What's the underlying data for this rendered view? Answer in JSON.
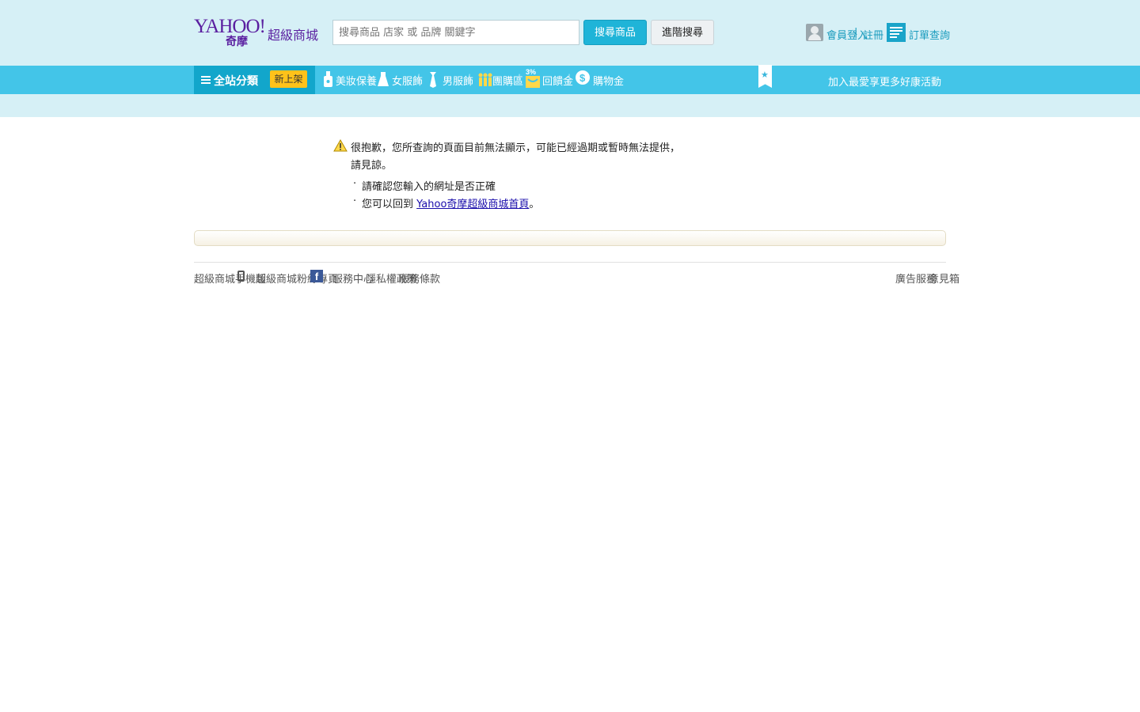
{
  "brand": {
    "logo_text": "YAHOO!",
    "logo_sub": "奇摩",
    "mall_name": "超級商城",
    "accent_color": "#43c5e8",
    "brand_color": "#5a1fa0"
  },
  "search": {
    "placeholder": "搜尋商品 店家 或 品牌 關鍵字",
    "search_button": "搜尋商品",
    "advanced_button": "進階搜尋"
  },
  "account": {
    "login_label": "會員登入",
    "separator": "|",
    "register_label": "註冊",
    "order_label": "訂單查詢"
  },
  "nav": {
    "all_categories": "全站分類",
    "badge": "新上架",
    "items": [
      {
        "label": "美妝保養",
        "icon": "bottle-icon"
      },
      {
        "label": "女服飾",
        "icon": "dress-icon"
      },
      {
        "label": "男服飾",
        "icon": "tie-icon"
      },
      {
        "label": "團購區",
        "icon": "people-icon"
      },
      {
        "label": "回饋金",
        "icon": "percent-bag-icon"
      },
      {
        "label": "購物金",
        "icon": "dollar-icon"
      }
    ],
    "bookmark_icon": "star-bookmark-icon",
    "promo_text": "加入最愛享更多好康活動"
  },
  "message": {
    "line1": "很抱歉，您所查詢的頁面目前無法顯示，可能已經過期或暫時無法提供，",
    "line2": "請見諒。",
    "tips": [
      {
        "text": "請確認您輸入的網址是否正確"
      },
      {
        "prefix": "您可以回到 ",
        "link": "Yahoo奇摩超級商城首頁",
        "suffix": "。"
      }
    ]
  },
  "footer": {
    "left": [
      {
        "label": "超級商城手機版",
        "icon": "phone-icon"
      },
      {
        "label": "超級商城粉絲專頁",
        "icon": "facebook-icon"
      },
      {
        "label": "服務中心"
      },
      {
        "label": "隱私權政策"
      },
      {
        "label": "服務條款"
      }
    ],
    "right": [
      "廣告服務",
      "意見箱"
    ]
  }
}
